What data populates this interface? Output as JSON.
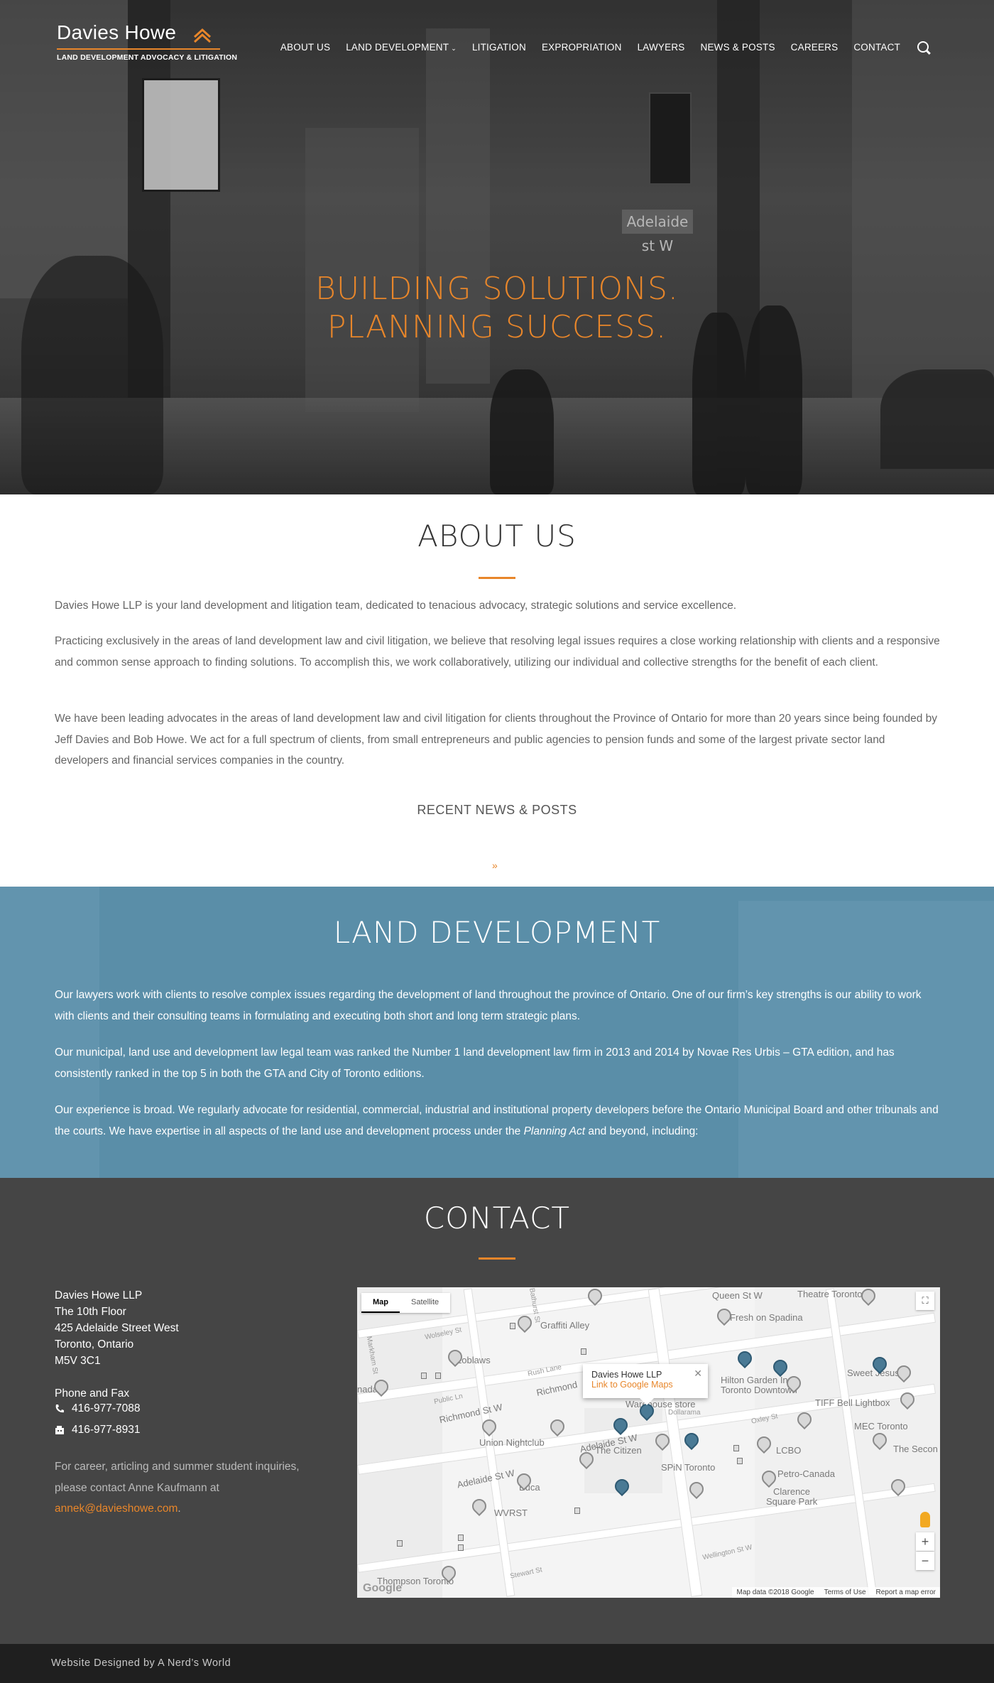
{
  "header": {
    "logo_name": "Davies Howe",
    "logo_tagline": "LAND DEVELOPMENT ADVOCACY & LITIGATION",
    "nav": [
      {
        "label": "ABOUT US"
      },
      {
        "label": "LAND DEVELOPMENT",
        "has_dropdown": true
      },
      {
        "label": "LITIGATION"
      },
      {
        "label": "EXPROPRIATION"
      },
      {
        "label": "LAWYERS"
      },
      {
        "label": "NEWS & POSTS"
      },
      {
        "label": "CAREERS"
      },
      {
        "label": "CONTACT"
      }
    ],
    "search_icon": "search-icon"
  },
  "hero": {
    "line1": "BUILDING SOLUTIONS.",
    "line2": "PLANNING SUCCESS.",
    "street_sign": "Adelaide st W",
    "accent_color": "#e8862a"
  },
  "about": {
    "title": "ABOUT US",
    "p1": "Davies Howe LLP is your land development and litigation team, dedicated to tenacious advocacy, strategic solutions and service excellence.",
    "p2": "Practicing exclusively in the areas of land development law and civil litigation, we believe that resolving legal issues requires a close working relationship with clients and a responsive and common sense approach to finding solutions. To accomplish this, we work collaboratively, utilizing our individual and collective strengths for the benefit of each client.",
    "p3": "We have been leading advocates in the areas of land development law and civil litigation for clients throughout the Province of Ontario for more than 20 years since being founded by Jeff Davies and Bob Howe. We act for a full spectrum of clients, from small entrepreneurs and public agencies to pension funds and some of the largest private sector land developers and financial services companies in the country.",
    "recent_label": "RECENT NEWS & POSTS"
  },
  "land": {
    "title": "LAND DEVELOPMENT",
    "p1": "Our lawyers work with clients to resolve complex issues regarding the development of land throughout the province of Ontario. One of our firm’s key strengths is our ability to work with clients and their consulting teams in formulating and executing both short and long term strategic plans.",
    "p2": "Our municipal, land use and development law legal team was ranked the Number 1 land development law firm in 2013 and 2014 by Novae Res Urbis – GTA edition, and has consistently ranked in the top 5 in both the GTA and City of Toronto editions.",
    "p3a": "Our experience is broad. We regularly advocate for residential, commercial,  industrial and institutional property developers before the Ontario Municipal Board and other tribunals and the courts. We have expertise in all aspects of the land use and development process under the ",
    "p3b": "Planning Act",
    "p3c": " and beyond, including:",
    "bg_color": "#5a8ea8"
  },
  "contact": {
    "title": "CONTACT",
    "address": [
      "Davies Howe LLP",
      "The 10th Floor",
      "425 Adelaide Street West",
      "Toronto, Ontario",
      "M5V 3C1"
    ],
    "phone_fax_label": "Phone and Fax",
    "phone": "416-977-7088",
    "fax": "416-977-8931",
    "career_text": "For career, articling and summer student inquiries, please contact Anne Kaufmann at",
    "career_email": "annek@davieshowe.com",
    "career_end": "."
  },
  "map": {
    "tabs": [
      "Map",
      "Satellite"
    ],
    "active_tab": "Map",
    "info_title": "Davies Howe LLP",
    "info_link": "Link to Google Maps",
    "labels": {
      "queen": "Queen St W",
      "theatre": "Theatre Toronto",
      "graffiti": "Graffiti Alley",
      "spadina": "Fresh on Spadina",
      "loblaws": "Loblaws",
      "hilton1": "Hilton Garden Inn",
      "hilton2": "Toronto Downtown",
      "sweet": "Sweet Jesus",
      "tiff": "TIFF Bell Lightbox",
      "richmond1": "Richmond St W",
      "richmond2": "Richmond",
      "warehouse": "Warehouse store",
      "dollarama": "Dollarama",
      "mec": "MEC Toronto",
      "union": "Union Nightclub",
      "adelaide1": "Adelaide St W",
      "adelaide2": "Adelaide St W",
      "citizen": "The Citizen",
      "lcbo": "LCBO",
      "second": "The Secon",
      "buca": "Buca",
      "spin": "SPiN Toronto",
      "petro": "Petro-Canada",
      "clarence1": "Clarence",
      "clarence2": "Square Park",
      "wvrst": "WVRST",
      "simpson": "Thompson Toronto",
      "nada": "nada",
      "public": "Public Ln",
      "wolseley": "Wolseley St",
      "rush": "Rush Lane",
      "oxley": "Oxley St",
      "stewart": "Stewart St",
      "wellington": "Wellington St W",
      "markham": "Markham St",
      "bathurst": "Bathurst St"
    },
    "footer_items": [
      "Map data ©2018 Google",
      "Terms of Use",
      "Report a map error"
    ],
    "google": "Google"
  },
  "footer": {
    "credit": "Website Designed by A Nerd’s World"
  }
}
